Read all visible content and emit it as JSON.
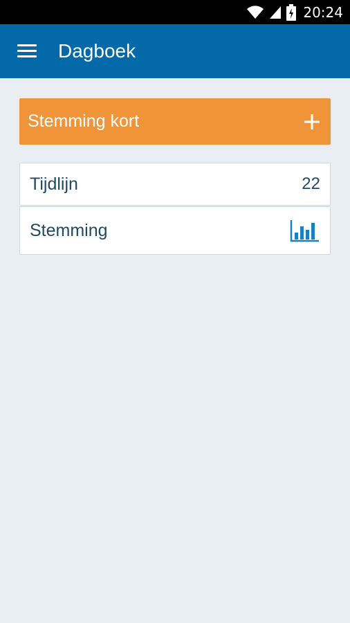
{
  "status_bar": {
    "time": "20:24"
  },
  "app_bar": {
    "title": "Dagboek"
  },
  "quick_entry": {
    "label": "Stemming kort",
    "icon": "plus-icon"
  },
  "list": {
    "timeline": {
      "label": "Tijdlijn",
      "count": "22"
    },
    "mood": {
      "label": "Stemming",
      "icon": "bar-chart-icon"
    }
  },
  "colors": {
    "app_bar": "#0369a9",
    "accent": "#ef9438",
    "background": "#e8eef2",
    "text": "#1f4a63",
    "chart_icon": "#1a7fc0"
  }
}
